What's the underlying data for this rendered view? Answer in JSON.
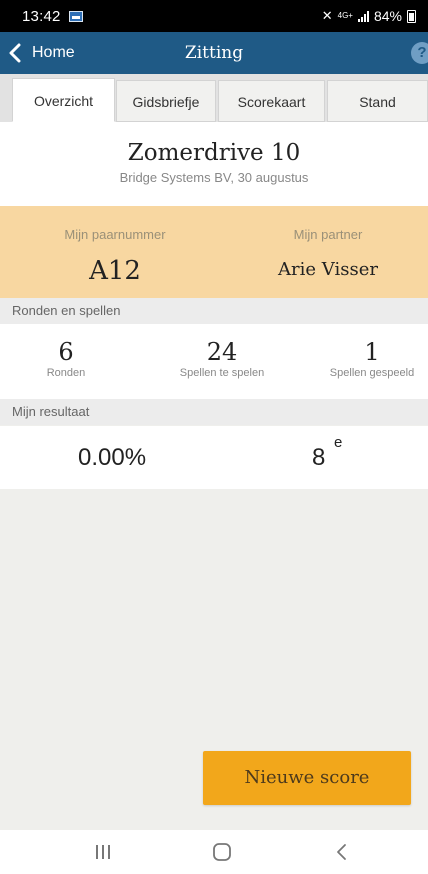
{
  "status_bar": {
    "time": "13:42",
    "network": "4G+",
    "battery": "84%",
    "icons": [
      "gallery-icon",
      "mute-icon",
      "signal-icon",
      "battery-icon"
    ]
  },
  "nav": {
    "back_label": "Home",
    "title": "Zitting",
    "help_label": "?"
  },
  "tabs": [
    {
      "label": "Overzicht",
      "active": true
    },
    {
      "label": "Gidsbriefje",
      "active": false
    },
    {
      "label": "Scorekaart",
      "active": false
    },
    {
      "label": "Stand",
      "active": false
    }
  ],
  "session": {
    "name": "Zomerdrive 10",
    "subtitle": "Bridge Systems BV,  30 augustus"
  },
  "pair": {
    "number_label": "Mijn paarnummer",
    "number": "A12",
    "partner_label": "Mijn partner",
    "partner": "Arie Visser"
  },
  "rounds": {
    "section_label": "Ronden en spellen",
    "stats": [
      {
        "value": "6",
        "caption": "Ronden"
      },
      {
        "value": "24",
        "caption": "Spellen te spelen"
      },
      {
        "value": "1",
        "caption": "Spellen gespeeld"
      }
    ]
  },
  "result": {
    "section_label": "Mijn resultaat",
    "percentage": "0.00%",
    "rank": "8",
    "rank_suffix": "e"
  },
  "actions": {
    "new_score_label": "Nieuwe score"
  },
  "colors": {
    "nav_bar": "#1f5a86",
    "pair_band": "#f8d7a1",
    "accent_button": "#f2a71b"
  },
  "system_nav": [
    "recents-icon",
    "home-icon",
    "back-icon"
  ]
}
